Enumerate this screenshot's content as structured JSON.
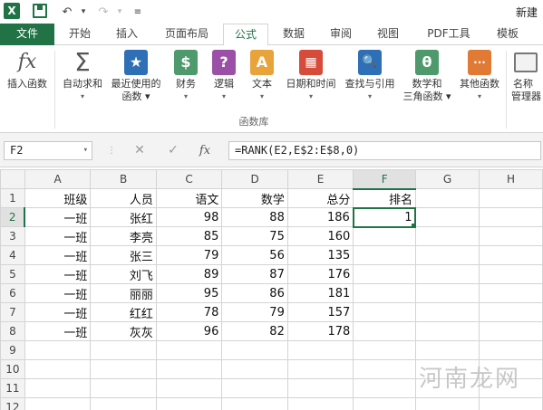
{
  "titlebar": {
    "app_icon": "X",
    "title": "新建"
  },
  "tabs": [
    {
      "label": "文件"
    },
    {
      "label": "开始"
    },
    {
      "label": "插入"
    },
    {
      "label": "页面布局"
    },
    {
      "label": "公式"
    },
    {
      "label": "数据"
    },
    {
      "label": "审阅"
    },
    {
      "label": "视图"
    },
    {
      "label": "PDF工具"
    },
    {
      "label": "模板"
    }
  ],
  "ribbon": {
    "insert_function": {
      "icon": "fx",
      "label": "插入函数"
    },
    "autosum": {
      "icon": "Σ",
      "label1": "自动求和",
      "caret": "▾"
    },
    "recent": {
      "icon": "★",
      "label1": "最近使用的",
      "label2": "函数 ▾"
    },
    "finance": {
      "icon": "$",
      "label1": "财务",
      "caret": "▾"
    },
    "logic": {
      "icon": "?",
      "label1": "逻辑",
      "caret": "▾"
    },
    "text": {
      "icon": "A",
      "label1": "文本",
      "caret": "▾"
    },
    "datetime": {
      "icon": "▦",
      "label1": "日期和时间",
      "caret": "▾"
    },
    "lookup": {
      "icon": "🔍",
      "label1": "查找与引用",
      "caret": "▾"
    },
    "math": {
      "icon": "θ",
      "label1": "数学和",
      "label2": "三角函数 ▾"
    },
    "other": {
      "icon": "···",
      "label1": "其他函数",
      "caret": "▾"
    },
    "name_manager": {
      "label1": "名称",
      "label2": "管理器"
    },
    "group_label": "函数库"
  },
  "formula_bar": {
    "name_box": "F2",
    "cancel_icon": "✕",
    "enter_icon": "✓",
    "fx_icon": "fx",
    "formula": "=RANK(E2,E$2:E$8,0)"
  },
  "grid": {
    "columns": [
      "A",
      "B",
      "C",
      "D",
      "E",
      "F",
      "G",
      "H"
    ],
    "rows": [
      {
        "n": "1",
        "cells": [
          "班级",
          "人员",
          "语文",
          "数学",
          "总分",
          "排名",
          "",
          ""
        ]
      },
      {
        "n": "2",
        "cells": [
          "一班",
          "张红",
          "98",
          "88",
          "186",
          "1",
          "",
          ""
        ]
      },
      {
        "n": "3",
        "cells": [
          "一班",
          "李亮",
          "85",
          "75",
          "160",
          "",
          "",
          ""
        ]
      },
      {
        "n": "4",
        "cells": [
          "一班",
          "张三",
          "79",
          "56",
          "135",
          "",
          "",
          ""
        ]
      },
      {
        "n": "5",
        "cells": [
          "一班",
          "刘飞",
          "89",
          "87",
          "176",
          "",
          "",
          ""
        ]
      },
      {
        "n": "6",
        "cells": [
          "一班",
          "丽丽",
          "95",
          "86",
          "181",
          "",
          "",
          ""
        ]
      },
      {
        "n": "7",
        "cells": [
          "一班",
          "红红",
          "78",
          "79",
          "157",
          "",
          "",
          ""
        ]
      },
      {
        "n": "8",
        "cells": [
          "一班",
          "灰灰",
          "96",
          "82",
          "178",
          "",
          "",
          ""
        ]
      },
      {
        "n": "9",
        "cells": [
          "",
          "",
          "",
          "",
          "",
          "",
          "",
          ""
        ]
      },
      {
        "n": "10",
        "cells": [
          "",
          "",
          "",
          "",
          "",
          "",
          "",
          ""
        ]
      },
      {
        "n": "11",
        "cells": [
          "",
          "",
          "",
          "",
          "",
          "",
          "",
          ""
        ]
      },
      {
        "n": "12",
        "cells": [
          "",
          "",
          "",
          "",
          "",
          "",
          "",
          ""
        ]
      }
    ]
  },
  "watermark": "河南龙网"
}
